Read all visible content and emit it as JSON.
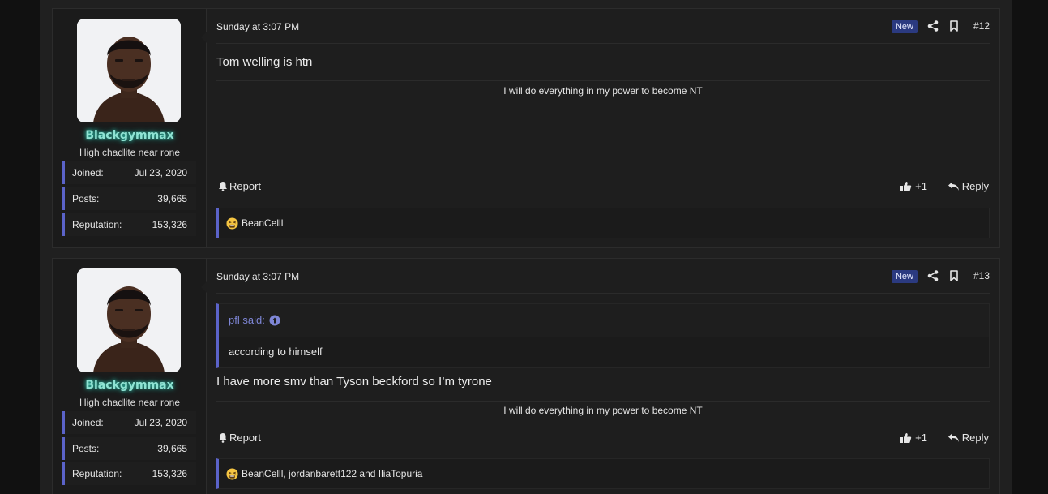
{
  "posts": [
    {
      "user": {
        "name": "Blackgymmax",
        "title": "High chadlite near rone",
        "stats": [
          {
            "label": "Joined:",
            "value": "Jul 23, 2020"
          },
          {
            "label": "Posts:",
            "value": "39,665"
          },
          {
            "label": "Reputation:",
            "value": "153,326"
          }
        ]
      },
      "date": "Sunday at 3:07 PM",
      "badge": "New",
      "number": "#12",
      "body": "Tom welling is htn",
      "signature": "I will do everything in my power to become NT",
      "report_label": "Report",
      "like_count": "+1",
      "reply_label": "Reply",
      "reactions": "BeanCelll"
    },
    {
      "user": {
        "name": "Blackgymmax",
        "title": "High chadlite near rone",
        "stats": [
          {
            "label": "Joined:",
            "value": "Jul 23, 2020"
          },
          {
            "label": "Posts:",
            "value": "39,665"
          },
          {
            "label": "Reputation:",
            "value": "153,326"
          }
        ]
      },
      "date": "Sunday at 3:07 PM",
      "badge": "New",
      "number": "#13",
      "quote": {
        "author": "pfl said:",
        "text": "according to himself"
      },
      "body": "I have more smv than Tyson beckford so I’m tyrone",
      "signature": "I will do everything in my power to become NT",
      "report_label": "Report",
      "like_count": "+1",
      "reply_label": "Reply",
      "reactions": "BeanCelll, jordanbarett122 and IliaTopuria"
    }
  ],
  "colors": {
    "accent": "#5b63c9",
    "username_glow": "#8fe3d3",
    "badge_bg": "#2b3a80"
  },
  "icons": [
    "share-icon",
    "bookmark-icon",
    "bell-icon",
    "thumbs-up-icon",
    "reply-icon",
    "up-arrow-circle-icon",
    "tired-face-emoji"
  ]
}
